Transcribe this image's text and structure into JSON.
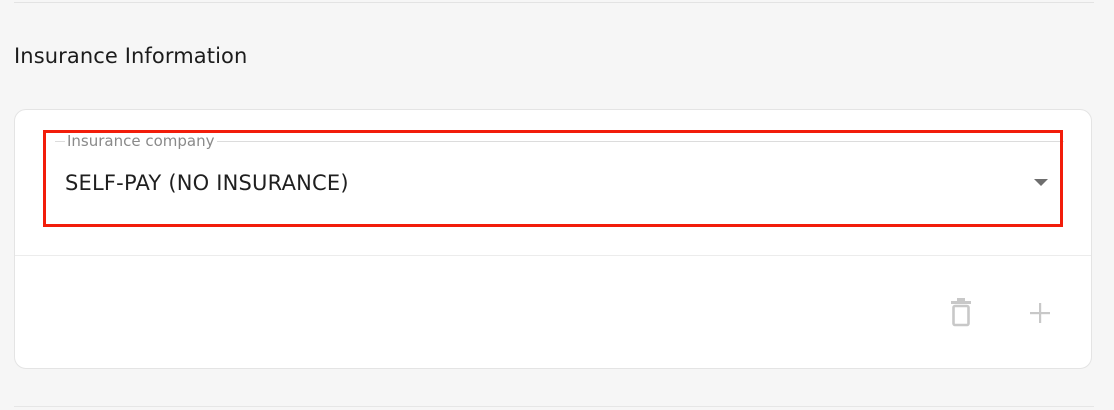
{
  "section": {
    "title": "Insurance Information"
  },
  "insurance_select": {
    "label": "Insurance company",
    "value": "SELF-PAY (NO INSURANCE)"
  },
  "actions": {
    "delete_icon": "trash-icon",
    "add_icon": "plus-icon"
  },
  "colors": {
    "highlight": "#f21d0a",
    "icon_disabled": "#c8c8c8",
    "background": "#f6f6f6",
    "card": "#ffffff"
  }
}
